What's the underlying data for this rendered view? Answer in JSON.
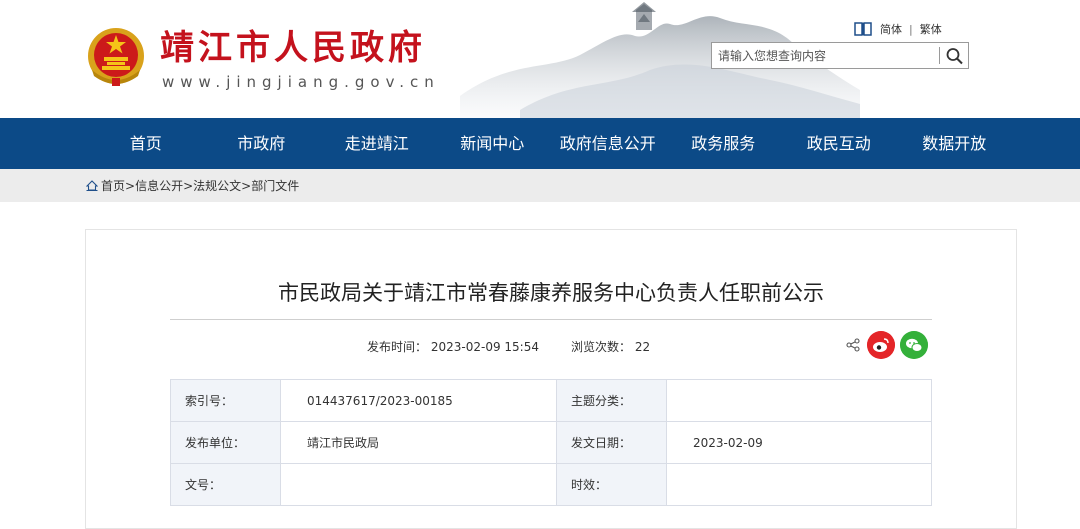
{
  "header": {
    "site_title": "靖江市人民政府",
    "site_domain": "www.jingjiang.gov.cn",
    "lang_simplified": "简体",
    "lang_separator": "|",
    "lang_traditional": "繁体",
    "search_placeholder": "请输入您想查询内容"
  },
  "nav": {
    "items": [
      "首页",
      "市政府",
      "走进靖江",
      "新闻中心",
      "政府信息公开",
      "政务服务",
      "政民互动",
      "数据开放"
    ]
  },
  "breadcrumb": {
    "items": [
      "首页",
      "信息公开",
      "法规公文",
      "部门文件"
    ],
    "separator": ">"
  },
  "article": {
    "title": "市民政局关于靖江市常春藤康养服务中心负责人任职前公示",
    "publish_label": "发布时间：",
    "publish_time": "2023-02-09 15:54",
    "views_label": "浏览次数：",
    "views_count": "22"
  },
  "info_table": {
    "rows": [
      {
        "k1": "索引号：",
        "v1": "014437617/2023-00185",
        "k2": "主题分类：",
        "v2": ""
      },
      {
        "k1": "发布单位：",
        "v1": "靖江市民政局",
        "k2": "发文日期：",
        "v2": "2023-02-09"
      },
      {
        "k1": "文号：",
        "v1": "",
        "k2": "时效：",
        "v2": ""
      }
    ]
  },
  "colors": {
    "nav_bg": "#0c4a87",
    "title_red": "#c4121d",
    "weibo_red": "#e42528",
    "wechat_green": "#34b03a"
  },
  "icons": [
    "emblem-logo",
    "book-icon",
    "search-icon",
    "home-icon",
    "share-icon",
    "weibo-icon",
    "wechat-icon"
  ]
}
